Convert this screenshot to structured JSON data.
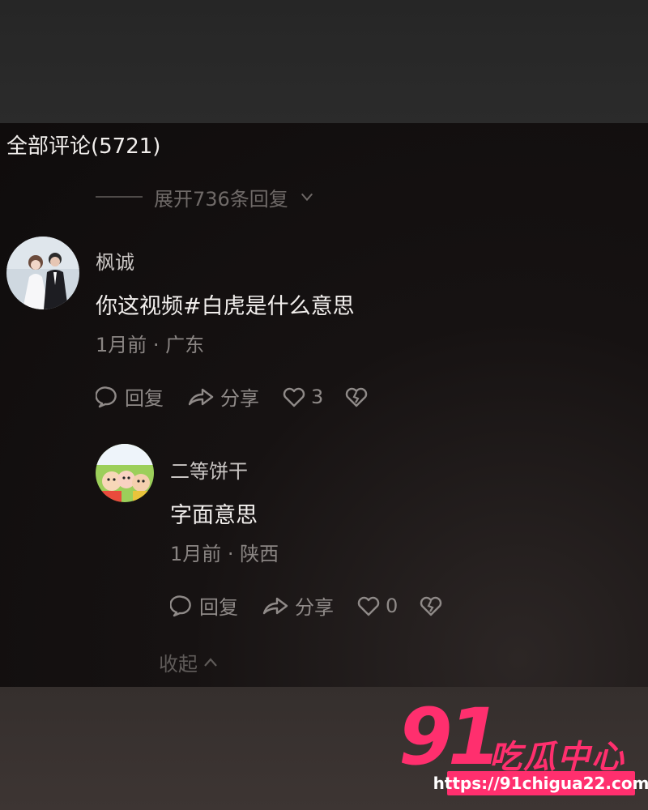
{
  "comments_header": {
    "title": "全部评论(5721)"
  },
  "expand_replies": {
    "label": "展开736条回复"
  },
  "comment_main": {
    "username": "枫诚",
    "text": "你这视频#白虎是什么意思",
    "meta": "1月前 · 广东",
    "actions": {
      "reply_label": "回复",
      "share_label": "分享",
      "like_count": "3"
    }
  },
  "reply_1": {
    "username": "二等饼干",
    "text": "字面意思",
    "meta": "1月前 · 陕西",
    "actions": {
      "reply_label": "回复",
      "share_label": "分享",
      "like_count": "0"
    }
  },
  "collapse": {
    "label": "收起"
  },
  "watermark": {
    "logo_number": "91",
    "logo_text": "吃瓜中心",
    "url": "https://91chigua22.com"
  },
  "colors": {
    "accent": "#ff2f6e",
    "panel_bg": "#120e0e"
  }
}
